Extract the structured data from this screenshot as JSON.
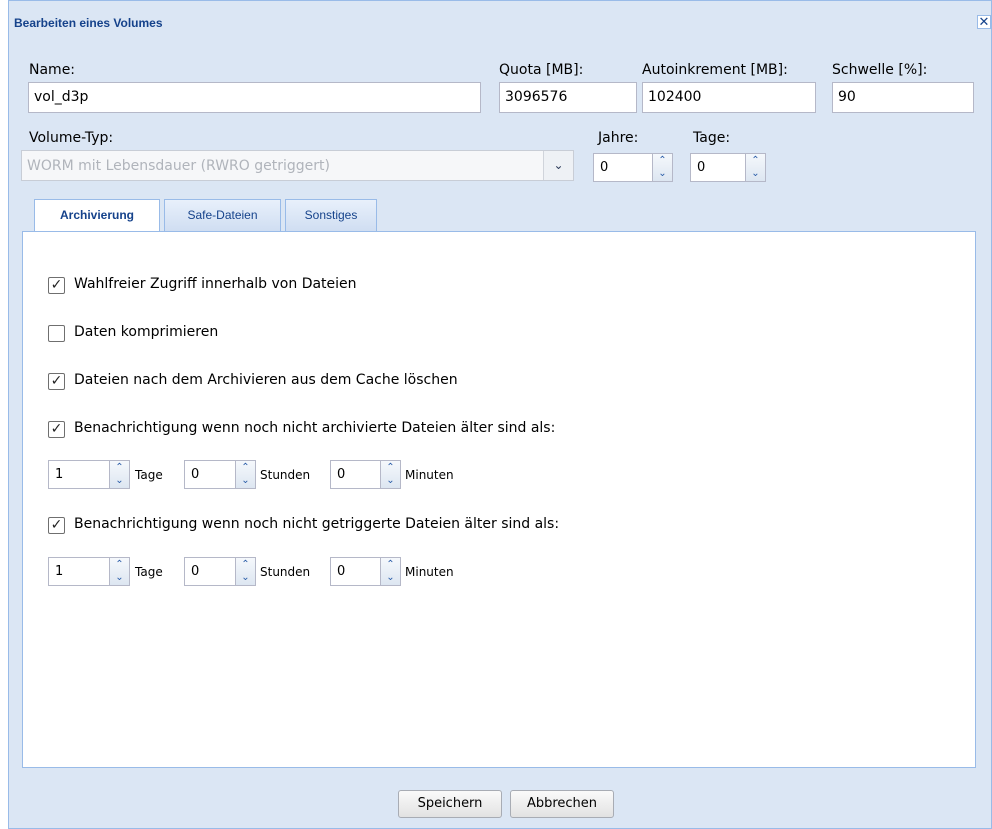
{
  "window": {
    "title": "Bearbeiten eines Volumes",
    "close_symbol": "✕"
  },
  "fields": {
    "name": {
      "label": "Name:",
      "value": "vol_d3p"
    },
    "quota": {
      "label": "Quota [MB]:",
      "value": "3096576"
    },
    "autoinkrement": {
      "label": "Autoinkrement [MB]:",
      "value": "102400"
    },
    "schwelle": {
      "label": "Schwelle [%]:",
      "value": "90"
    },
    "volume_typ": {
      "label": "Volume-Typ:",
      "value": "WORM mit Lebensdauer (RWRO getriggert)"
    },
    "jahre": {
      "label": "Jahre:",
      "value": "0"
    },
    "tage": {
      "label": "Tage:",
      "value": "0"
    }
  },
  "tabs": [
    {
      "label": "Archivierung",
      "active": true
    },
    {
      "label": "Safe-Dateien",
      "active": false
    },
    {
      "label": "Sonstiges",
      "active": false
    }
  ],
  "options": [
    {
      "label": "Wahlfreier Zugriff innerhalb von Dateien",
      "checked": true
    },
    {
      "label": "Daten komprimieren",
      "checked": false
    },
    {
      "label": "Dateien nach dem Archivieren aus dem Cache löschen",
      "checked": true
    },
    {
      "label": "Benachrichtigung wenn noch nicht archivierte Dateien älter sind als:",
      "checked": true
    },
    {
      "label": "Benachrichtigung wenn noch nicht getriggerte Dateien älter sind als:",
      "checked": true
    }
  ],
  "check_mark": "✓",
  "archived_age": {
    "tage": "1",
    "stunden": "0",
    "minuten": "0"
  },
  "triggered_age": {
    "tage": "1",
    "stunden": "0",
    "minuten": "0"
  },
  "units": {
    "tage": "Tage",
    "stunden": "Stunden",
    "minuten": "Minuten"
  },
  "buttons": {
    "save": "Speichern",
    "cancel": "Abbrechen"
  },
  "icons": {
    "spin_up": "⌃",
    "spin_down": "⌄",
    "combo_arrow": "⌄"
  },
  "colors": {
    "accent": "#15428b",
    "frame": "#dbe6f4",
    "border": "#99bbe8"
  }
}
